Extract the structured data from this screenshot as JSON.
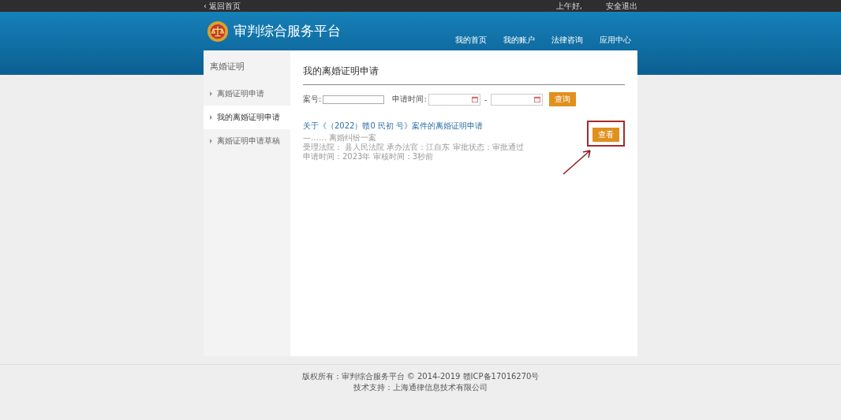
{
  "top_bar": {
    "back_link": "‹ 返回首页",
    "greeting": "上午好,",
    "logout": "安全退出"
  },
  "header": {
    "title": "审判综合服务平台",
    "nav": [
      {
        "label": "我的首页",
        "selected": false
      },
      {
        "label": "我的账户",
        "selected": false
      },
      {
        "label": "法律咨询",
        "selected": false
      },
      {
        "label": "应用中心",
        "selected": false
      }
    ]
  },
  "sidebar": {
    "title": "离婚证明",
    "items": [
      {
        "label": "离婚证明申请",
        "selected": false
      },
      {
        "label": "我的离婚证明申请",
        "selected": true
      },
      {
        "label": "离婚证明申请草稿",
        "selected": false
      }
    ]
  },
  "main": {
    "title": "我的离婚证明申请",
    "filters": {
      "case_label": "案号:",
      "date_label": "申请时间:",
      "separator": "-",
      "search_button": "查询"
    },
    "results": [
      {
        "title": "关于《（2022）赣0    民初    号》案件的离婚证明申请",
        "subtitle": "—……   离婚纠纷一案",
        "details": "受理法院：        县人民法院 承办法官：江自东 审批状态：审批通过",
        "times": "申请时间：2023年 审核时间：3秒前",
        "button": "查看",
        "highlighted": true
      }
    ]
  },
  "footer": {
    "copyright": "版权所有：审判综合服务平台 © 2014-2019 赣ICP备17016270号",
    "support": "技术支持：上海通律信息技术有限公司"
  }
}
